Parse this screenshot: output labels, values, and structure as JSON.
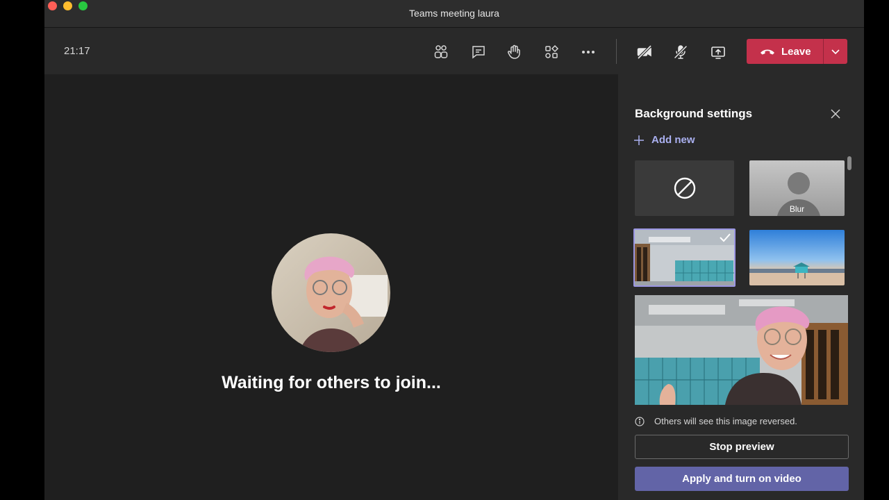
{
  "window": {
    "title": "Teams meeting laura"
  },
  "toolbar": {
    "timer": "21:17",
    "leave_label": "Leave",
    "buttons": [
      {
        "name": "participants-icon"
      },
      {
        "name": "chat-icon"
      },
      {
        "name": "raise-hand-icon"
      },
      {
        "name": "breakout-rooms-icon"
      },
      {
        "name": "more-options-icon"
      },
      {
        "name": "camera-off-icon"
      },
      {
        "name": "mic-off-icon"
      },
      {
        "name": "share-screen-icon"
      }
    ]
  },
  "stage": {
    "status_text": "Waiting for others to join..."
  },
  "panel": {
    "title": "Background settings",
    "add_new_label": "Add new",
    "thumbnails": [
      {
        "name": "none",
        "label": ""
      },
      {
        "name": "blur",
        "label": "Blur"
      },
      {
        "name": "office-lockers",
        "label": "",
        "selected": true
      },
      {
        "name": "beach-lifeguard",
        "label": ""
      }
    ],
    "info_text": "Others will see this image reversed.",
    "stop_preview_label": "Stop preview",
    "apply_label": "Apply and turn on video"
  },
  "colors": {
    "leave": "#c4314b",
    "accent": "#6264a7",
    "selected_border": "#9b96e3",
    "add_new_text": "#aab0f0"
  }
}
